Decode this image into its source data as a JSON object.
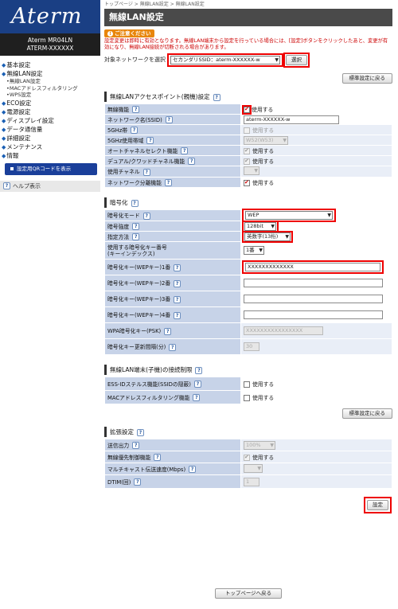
{
  "sidebar": {
    "logo": "Aterm",
    "model_line1": "Aterm MR04LN",
    "model_line2": "ATERM-XXXXXX",
    "nav": [
      {
        "type": "n",
        "label": "基本設定"
      },
      {
        "type": "n",
        "label": "無線LAN設定"
      },
      {
        "type": "s",
        "label": "•無線LAN設定"
      },
      {
        "type": "s",
        "label": "•MACアドレスフィルタリング"
      },
      {
        "type": "s",
        "label": "•WPS設定"
      },
      {
        "type": "n",
        "label": "ECO設定"
      },
      {
        "type": "n",
        "label": "電源設定"
      },
      {
        "type": "n",
        "label": "ディスプレイ設定"
      },
      {
        "type": "n",
        "label": "データ通信量"
      },
      {
        "type": "n",
        "label": "詳細設定"
      },
      {
        "type": "n",
        "label": "メンテナンス"
      },
      {
        "type": "n",
        "label": "情報"
      }
    ],
    "qr_button": "設定用QRコードを表示",
    "help": "ヘルプ表示"
  },
  "header": {
    "breadcrumb": "トップページ > 無線LAN設定 > 無線LAN設定",
    "title": "無線LAN設定"
  },
  "notice": {
    "label": "ご注意ください",
    "text": "設定変更は即時に有効となります。無線LAN端末から設定を行っている場合には、[設定]ボタンをクリックしたあと、変更が有効になり、無線LAN接続が切断される場合があります。"
  },
  "target": {
    "label": "対象ネットワークを選択",
    "value": "セカンダリSSID：aterm-XXXXXX-w",
    "select_button": "選択"
  },
  "buttons": {
    "defaults": "標準設定に戻る",
    "apply": "設定",
    "back_top": "トップページへ戻る"
  },
  "section_ap": {
    "heading": "無線LANアクセスポイント(親機)設定",
    "rows": {
      "wireless": {
        "label": "無線機能",
        "check": "使用する"
      },
      "ssid": {
        "label": "ネットワーク名(SSID)",
        "value": "aterm-XXXXXX-w"
      },
      "band5": {
        "label": "5GHz帯",
        "check": "使用する"
      },
      "band5_ch": {
        "label": "5GHz使用帯域",
        "value": "W52(W53)"
      },
      "auto_ch": {
        "label": "オートチャネルセレクト機能",
        "check": "使用する"
      },
      "dual_ch": {
        "label": "デュアル/クワッドチャネル機能",
        "check": "使用する"
      },
      "channel": {
        "label": "使用チャネル",
        "value": ""
      },
      "isolation": {
        "label": "ネットワーク分離機能",
        "check": "使用する"
      }
    }
  },
  "section_enc": {
    "heading": "暗号化",
    "rows": {
      "mode": {
        "label": "暗号化モード",
        "value": "WEP"
      },
      "strength": {
        "label": "暗号強度",
        "value": "128bit"
      },
      "method": {
        "label": "指定方法",
        "value": "英数字(13桁)"
      },
      "key_index": {
        "label1": "使用する暗号化キー番号",
        "label2": "(キーインデックス)",
        "value": "1番"
      },
      "key1": {
        "label": "暗号化キー(WEPキー)1番",
        "value": "XXXXXXXXXXXXX"
      },
      "key2": {
        "label": "暗号化キー(WEPキー)2番",
        "value": ""
      },
      "key3": {
        "label": "暗号化キー(WEPキー)3番",
        "value": ""
      },
      "key4": {
        "label": "暗号化キー(WEPキー)4番",
        "value": ""
      },
      "psk": {
        "label": "WPA暗号化キー(PSK)",
        "value": "XXXXXXXXXXXXXXXX"
      },
      "rekey": {
        "label": "暗号化キー更新間隔(分)",
        "value": "30"
      }
    }
  },
  "section_client": {
    "heading": "無線LAN端末(子機)の接続制限",
    "rows": {
      "stealth": {
        "label": "ESS-IDステルス機能(SSIDの隠蔽)",
        "check": "使用する"
      },
      "mac": {
        "label": "MACアドレスフィルタリング機能",
        "check": "使用する"
      }
    }
  },
  "section_ext": {
    "heading": "拡張設定",
    "rows": {
      "power": {
        "label": "送信出力",
        "value": "100%"
      },
      "priority": {
        "label": "無線優先制御機能",
        "check": "使用する"
      },
      "mcast": {
        "label": "マルチキャスト伝送速度(Mbps)",
        "value": ""
      },
      "dtim": {
        "label": "DTIM(回)",
        "value": "1"
      }
    }
  }
}
